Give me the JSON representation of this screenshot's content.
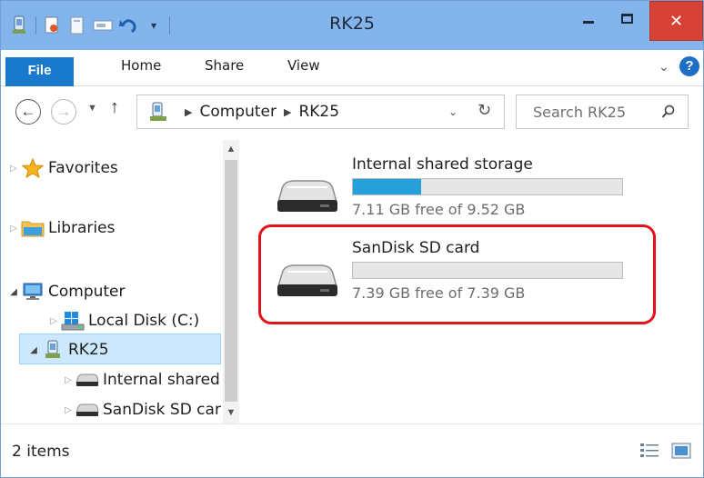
{
  "window": {
    "title": "RK25"
  },
  "ribbon": {
    "tabs": [
      {
        "label": "File"
      },
      {
        "label": "Home"
      },
      {
        "label": "Share"
      },
      {
        "label": "View"
      }
    ]
  },
  "address": {
    "crumbs": [
      "Computer",
      "RK25"
    ]
  },
  "search": {
    "placeholder": "Search RK25"
  },
  "nav": {
    "favorites": "Favorites",
    "libraries": "Libraries",
    "computer": "Computer",
    "local_disk": "Local Disk (C:)",
    "device": "RK25",
    "internal": "Internal shared",
    "sdcard": "SanDisk SD car"
  },
  "drives": [
    {
      "name": "Internal shared storage",
      "free_text": "7.11 GB free of 9.52 GB",
      "used_fraction": 0.253
    },
    {
      "name": "SanDisk SD card",
      "free_text": "7.39 GB free of 7.39 GB",
      "used_fraction": 0.0
    }
  ],
  "status": {
    "items": "2 items"
  },
  "colors": {
    "titlebar": "#84b4ec",
    "file_tab": "#1979ca",
    "close": "#d64236",
    "selection": "#cce8ff",
    "usage_bar": "#26a0da",
    "highlight": "#e0141a"
  }
}
